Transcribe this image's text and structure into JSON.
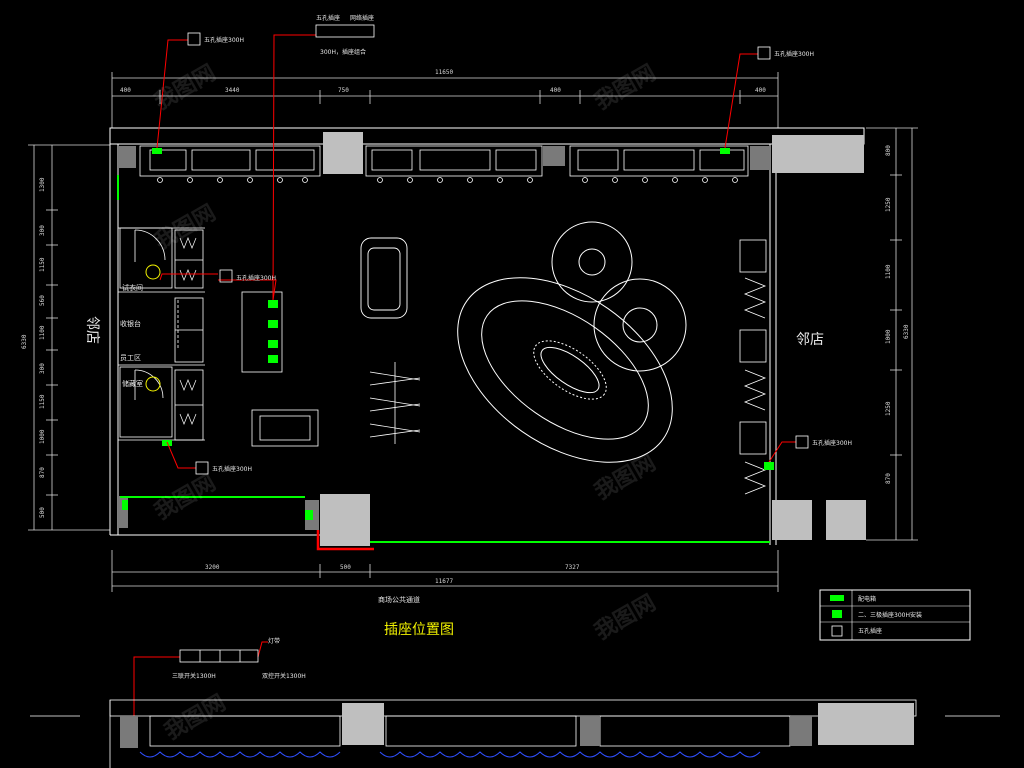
{
  "drawing": {
    "title": "插座位置图",
    "neighbor_left": "邻店",
    "neighbor_right": "邻店",
    "shop_front": "商场公共通道",
    "dim_top_total": "11650",
    "dim_bottom_total": "11677",
    "dim_top_segments": [
      "400",
      "3440",
      "750",
      "400",
      "400"
    ],
    "dim_bottom_segments": [
      "3200",
      "500",
      "7327"
    ],
    "dim_right_total": "6330",
    "dim_right_segments": [
      "800",
      "1250",
      "1100",
      "1000",
      "1250",
      "870"
    ],
    "dim_left_total": "6330",
    "dim_left_segments": [
      "1300",
      "300",
      "1150",
      "560",
      "1100",
      "300",
      "1150",
      "1000",
      "870",
      "500"
    ],
    "room_labels": {
      "fitting": "试衣间",
      "storage": "储藏室",
      "cashier": "收银台",
      "staff": "员工区"
    },
    "callouts": {
      "socket_top_left": "五孔插座300H",
      "socket_top_right": "五孔插座300H",
      "socket_mid": "五孔插座300H",
      "socket_bottom_left": "五孔插座300H",
      "socket_right": "五孔插座300H",
      "switch_group_a": "五孔插座",
      "switch_group_b": "网络插座",
      "switch_group_note": "300H，插座组合",
      "bottom_switch": "三联开关1300H",
      "bottom_switch_b": "双控开关1300H",
      "bottom_tag": "灯带"
    },
    "legend": {
      "items": [
        "配电箱",
        "二、三极插座300H安装",
        "五孔插座"
      ]
    },
    "watermark": "我图网",
    "colors": {
      "wall": "#ffffff",
      "socket": "#00ff00",
      "leader": "#ff0000",
      "fixture": "#bfbfbf",
      "title": "#f2f200",
      "curtain": "#2f4fff"
    }
  }
}
